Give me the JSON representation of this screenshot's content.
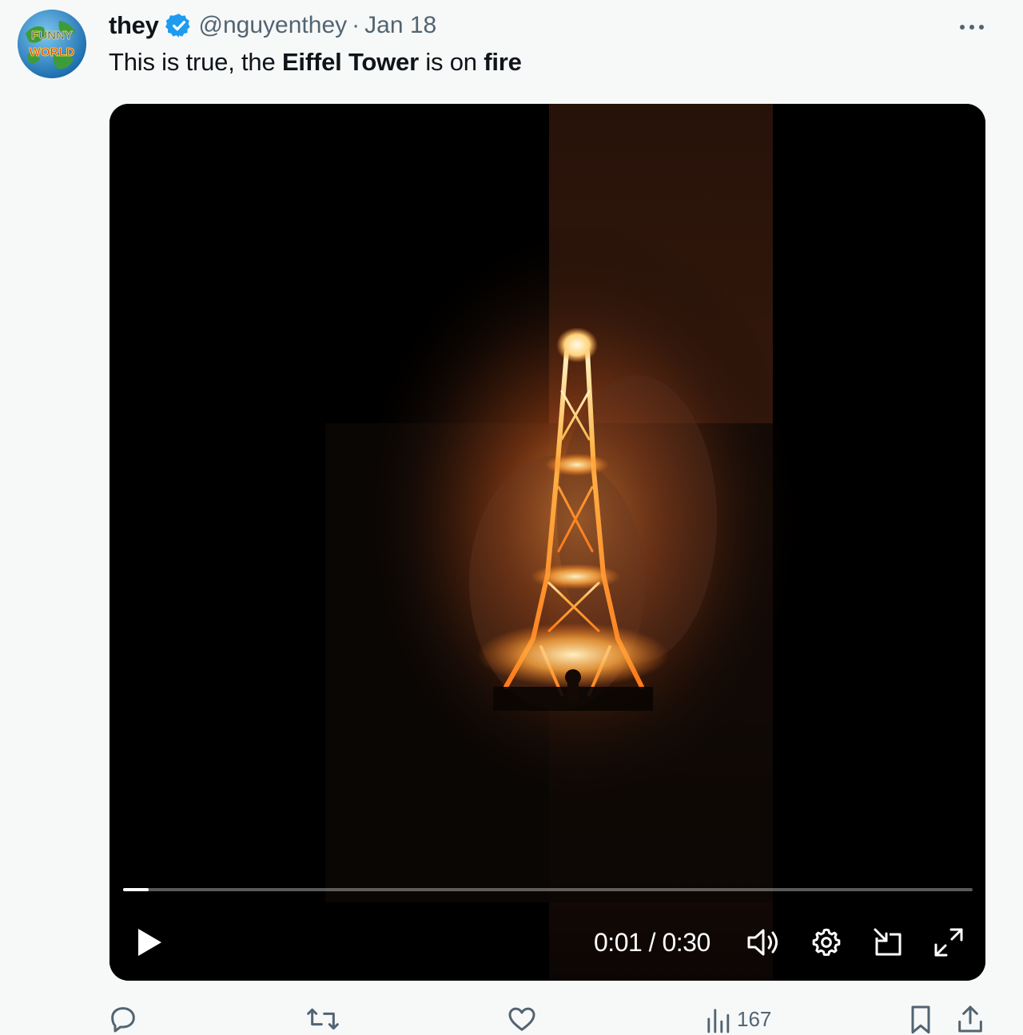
{
  "tweet": {
    "display_name": "they",
    "handle": "@nguyenthey",
    "separator": "·",
    "date": "Jan 18",
    "avatar_text_top": "FUNNY",
    "avatar_text_bottom": "WORLD",
    "text_part1": "This is true, the ",
    "text_bold1": "Eiffel Tower",
    "text_part2": " is on ",
    "text_bold2": "fire",
    "more_icon": "more-horizontal-icon"
  },
  "video": {
    "current_time": "0:01",
    "time_separator": " / ",
    "duration": "0:30",
    "progress": 0.03,
    "icons": {
      "play": "play-icon",
      "volume": "volume-icon",
      "settings": "gear-icon",
      "pip": "picture-in-picture-icon",
      "fullscreen": "fullscreen-icon"
    }
  },
  "actions": {
    "views_count": "167",
    "icons": [
      "reply-icon",
      "repost-icon",
      "like-icon",
      "views-icon",
      "bookmark-icon",
      "share-icon"
    ]
  },
  "colors": {
    "accent": "#1d9bf0",
    "secondary_text": "#536471",
    "background": "#f7f9f9"
  }
}
